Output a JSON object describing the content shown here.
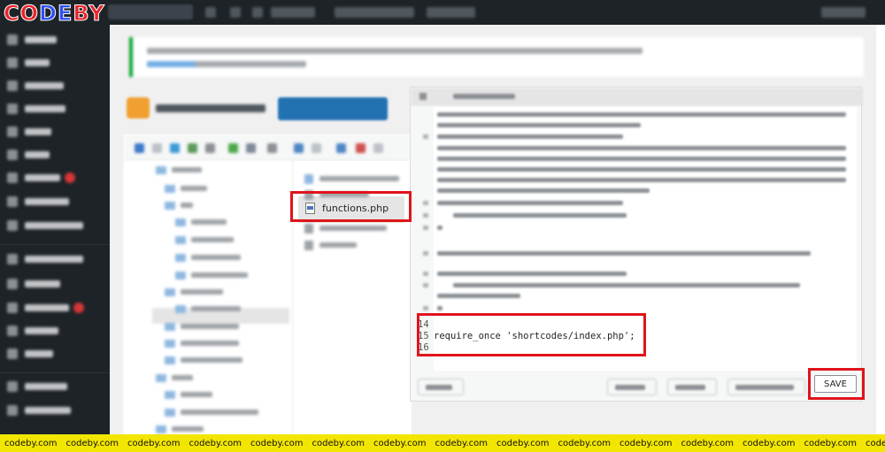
{
  "brand": {
    "logo_parts": [
      "CO",
      "DE",
      "BY"
    ]
  },
  "file_list": {
    "selected_file": "functions.php"
  },
  "editor": {
    "code_lines": [
      {
        "no": "14",
        "text": ""
      },
      {
        "no": "15",
        "text": "require_once 'shortcodes/index.php';"
      },
      {
        "no": "16",
        "text": ""
      }
    ],
    "save_label": "SAVE"
  },
  "watermark": {
    "text": "codeby.com",
    "repeat": 15
  },
  "colors": {
    "highlight_red": "#e0141b",
    "watermark_yellow": "#f2e600",
    "admin_dark": "#1d2327",
    "accent_blue": "#2271b1"
  },
  "icons": [
    "php-file-icon",
    "folder-icon"
  ]
}
